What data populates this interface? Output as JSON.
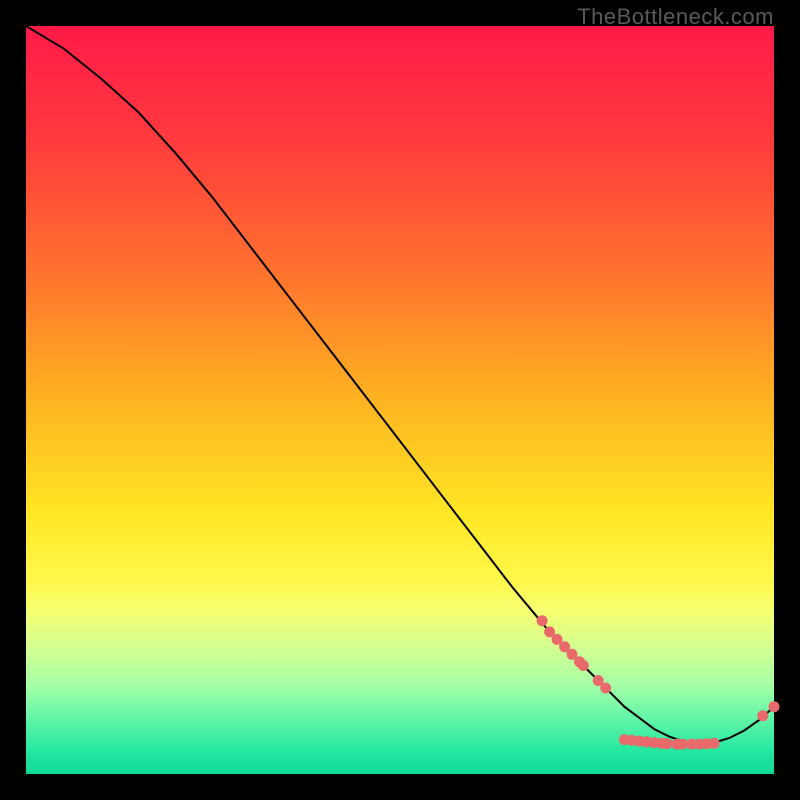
{
  "watermark": "TheBottleneck.com",
  "colors": {
    "gradient_stops": [
      {
        "offset": 0.0,
        "color": "#ff1a48"
      },
      {
        "offset": 0.15,
        "color": "#ff3a3e"
      },
      {
        "offset": 0.32,
        "color": "#ff6f2f"
      },
      {
        "offset": 0.5,
        "color": "#ffb321"
      },
      {
        "offset": 0.65,
        "color": "#ffe624"
      },
      {
        "offset": 0.74,
        "color": "#fff84a"
      },
      {
        "offset": 0.78,
        "color": "#f8ff70"
      },
      {
        "offset": 0.83,
        "color": "#d4ff90"
      },
      {
        "offset": 0.88,
        "color": "#a6ffa6"
      },
      {
        "offset": 0.92,
        "color": "#6bf7a8"
      },
      {
        "offset": 0.97,
        "color": "#22e7a0"
      },
      {
        "offset": 1.0,
        "color": "#10d99a"
      }
    ],
    "dot": "#e86a6a",
    "line": "#000000",
    "background": "#000000",
    "watermark": "#5a5a5a"
  },
  "chart_data": {
    "type": "line",
    "title": "",
    "xlabel": "",
    "ylabel": "",
    "xlim": [
      0,
      100
    ],
    "ylim": [
      0,
      100
    ],
    "grid": false,
    "legend": false,
    "series": [
      {
        "name": "curve",
        "x": [
          0,
          5,
          10,
          15,
          20,
          25,
          30,
          35,
          40,
          45,
          50,
          55,
          60,
          65,
          70,
          72,
          75,
          78,
          80,
          82,
          84,
          86,
          88,
          90,
          92,
          94,
          96,
          98,
          100
        ],
        "y": [
          100,
          97,
          93,
          88.5,
          83,
          77,
          70.5,
          64,
          57.5,
          51,
          44.5,
          38,
          31.5,
          25,
          19,
          17,
          14,
          11,
          9,
          7.5,
          6,
          5,
          4.3,
          4,
          4.2,
          4.8,
          5.8,
          7.2,
          9
        ]
      }
    ],
    "dots": [
      {
        "x": 69,
        "y": 20.5
      },
      {
        "x": 70,
        "y": 19
      },
      {
        "x": 71,
        "y": 18
      },
      {
        "x": 72,
        "y": 17
      },
      {
        "x": 73,
        "y": 16
      },
      {
        "x": 74,
        "y": 15
      },
      {
        "x": 74.5,
        "y": 14.5
      },
      {
        "x": 76.5,
        "y": 12.5
      },
      {
        "x": 77.5,
        "y": 11.5
      },
      {
        "x": 80,
        "y": 4.6
      },
      {
        "x": 81,
        "y": 4.5
      },
      {
        "x": 82,
        "y": 4.4
      },
      {
        "x": 83,
        "y": 4.3
      },
      {
        "x": 84,
        "y": 4.2
      },
      {
        "x": 85,
        "y": 4.1
      },
      {
        "x": 85.7,
        "y": 4.05
      },
      {
        "x": 87,
        "y": 4
      },
      {
        "x": 87.8,
        "y": 4
      },
      {
        "x": 89,
        "y": 4
      },
      {
        "x": 90,
        "y": 4
      },
      {
        "x": 91,
        "y": 4.05
      },
      {
        "x": 92,
        "y": 4.1
      },
      {
        "x": 98.5,
        "y": 7.8
      },
      {
        "x": 100,
        "y": 9
      }
    ]
  }
}
